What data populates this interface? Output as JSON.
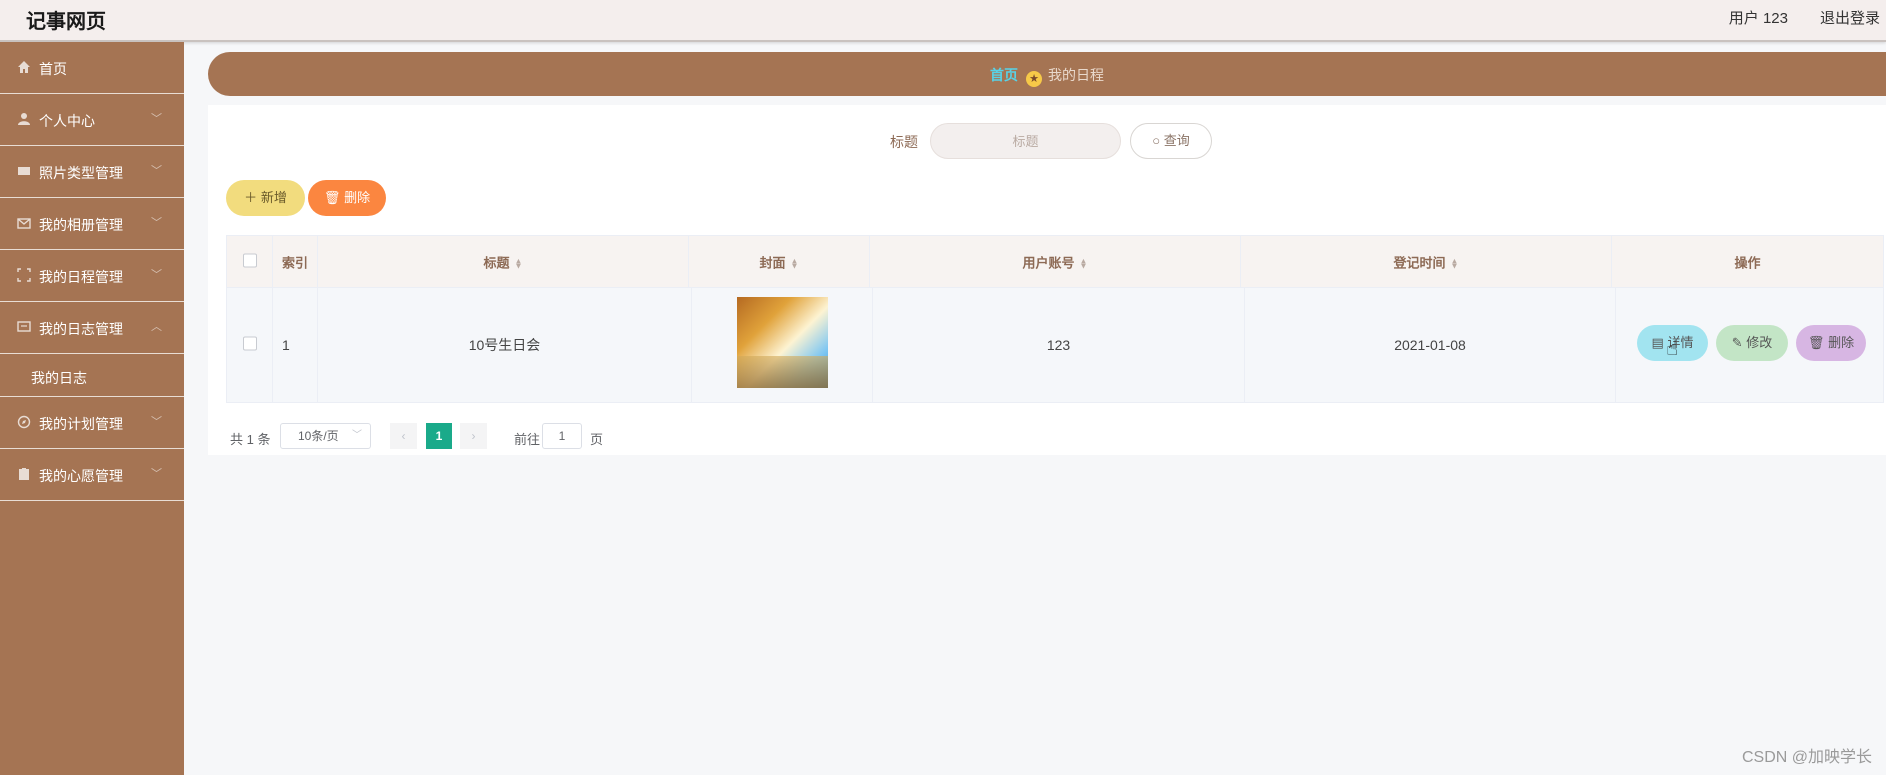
{
  "app": {
    "title": "记事网页"
  },
  "header": {
    "user": "用户 123",
    "logout": "退出登录"
  },
  "sidebar": {
    "items": [
      {
        "label": "首页",
        "icon": "home-icon"
      },
      {
        "label": "个人中心",
        "icon": "user-icon"
      },
      {
        "label": "照片类型管理",
        "icon": "ticket-icon"
      },
      {
        "label": "我的相册管理",
        "icon": "mail-icon"
      },
      {
        "label": "我的日程管理",
        "icon": "frame-icon"
      },
      {
        "label": "我的日志管理",
        "icon": "message-icon",
        "expanded": true,
        "children": [
          {
            "label": "我的日志"
          }
        ]
      },
      {
        "label": "我的计划管理",
        "icon": "compass-icon"
      },
      {
        "label": "我的心愿管理",
        "icon": "clipboard-icon"
      }
    ]
  },
  "breadcrumb": {
    "home": "首页",
    "current": "我的日程"
  },
  "search": {
    "label": "标题",
    "placeholder": "标题",
    "button": "查询"
  },
  "actions": {
    "add": "新增",
    "delete": "删除"
  },
  "table": {
    "columns": [
      "索引",
      "标题",
      "封面",
      "用户账号",
      "登记时间",
      "操作"
    ],
    "rows": [
      {
        "index": "1",
        "title": "10号生日会",
        "account": "123",
        "date": "2021-01-08"
      }
    ],
    "row_actions": {
      "detail": "详情",
      "edit": "修改",
      "delete": "删除"
    }
  },
  "pagination": {
    "total": "共 1 条",
    "page_size": "10条/页",
    "current": "1",
    "goto": "前往",
    "jump_value": "1",
    "unit": "页"
  },
  "watermark": "CSDN @加映学长",
  "colors": {
    "sidebar": "#a57453",
    "accent_home": "#58d2e6",
    "page_active": "#1aaa8a",
    "add_button": "#f2dc7e",
    "delete_button": "#fb8640"
  }
}
